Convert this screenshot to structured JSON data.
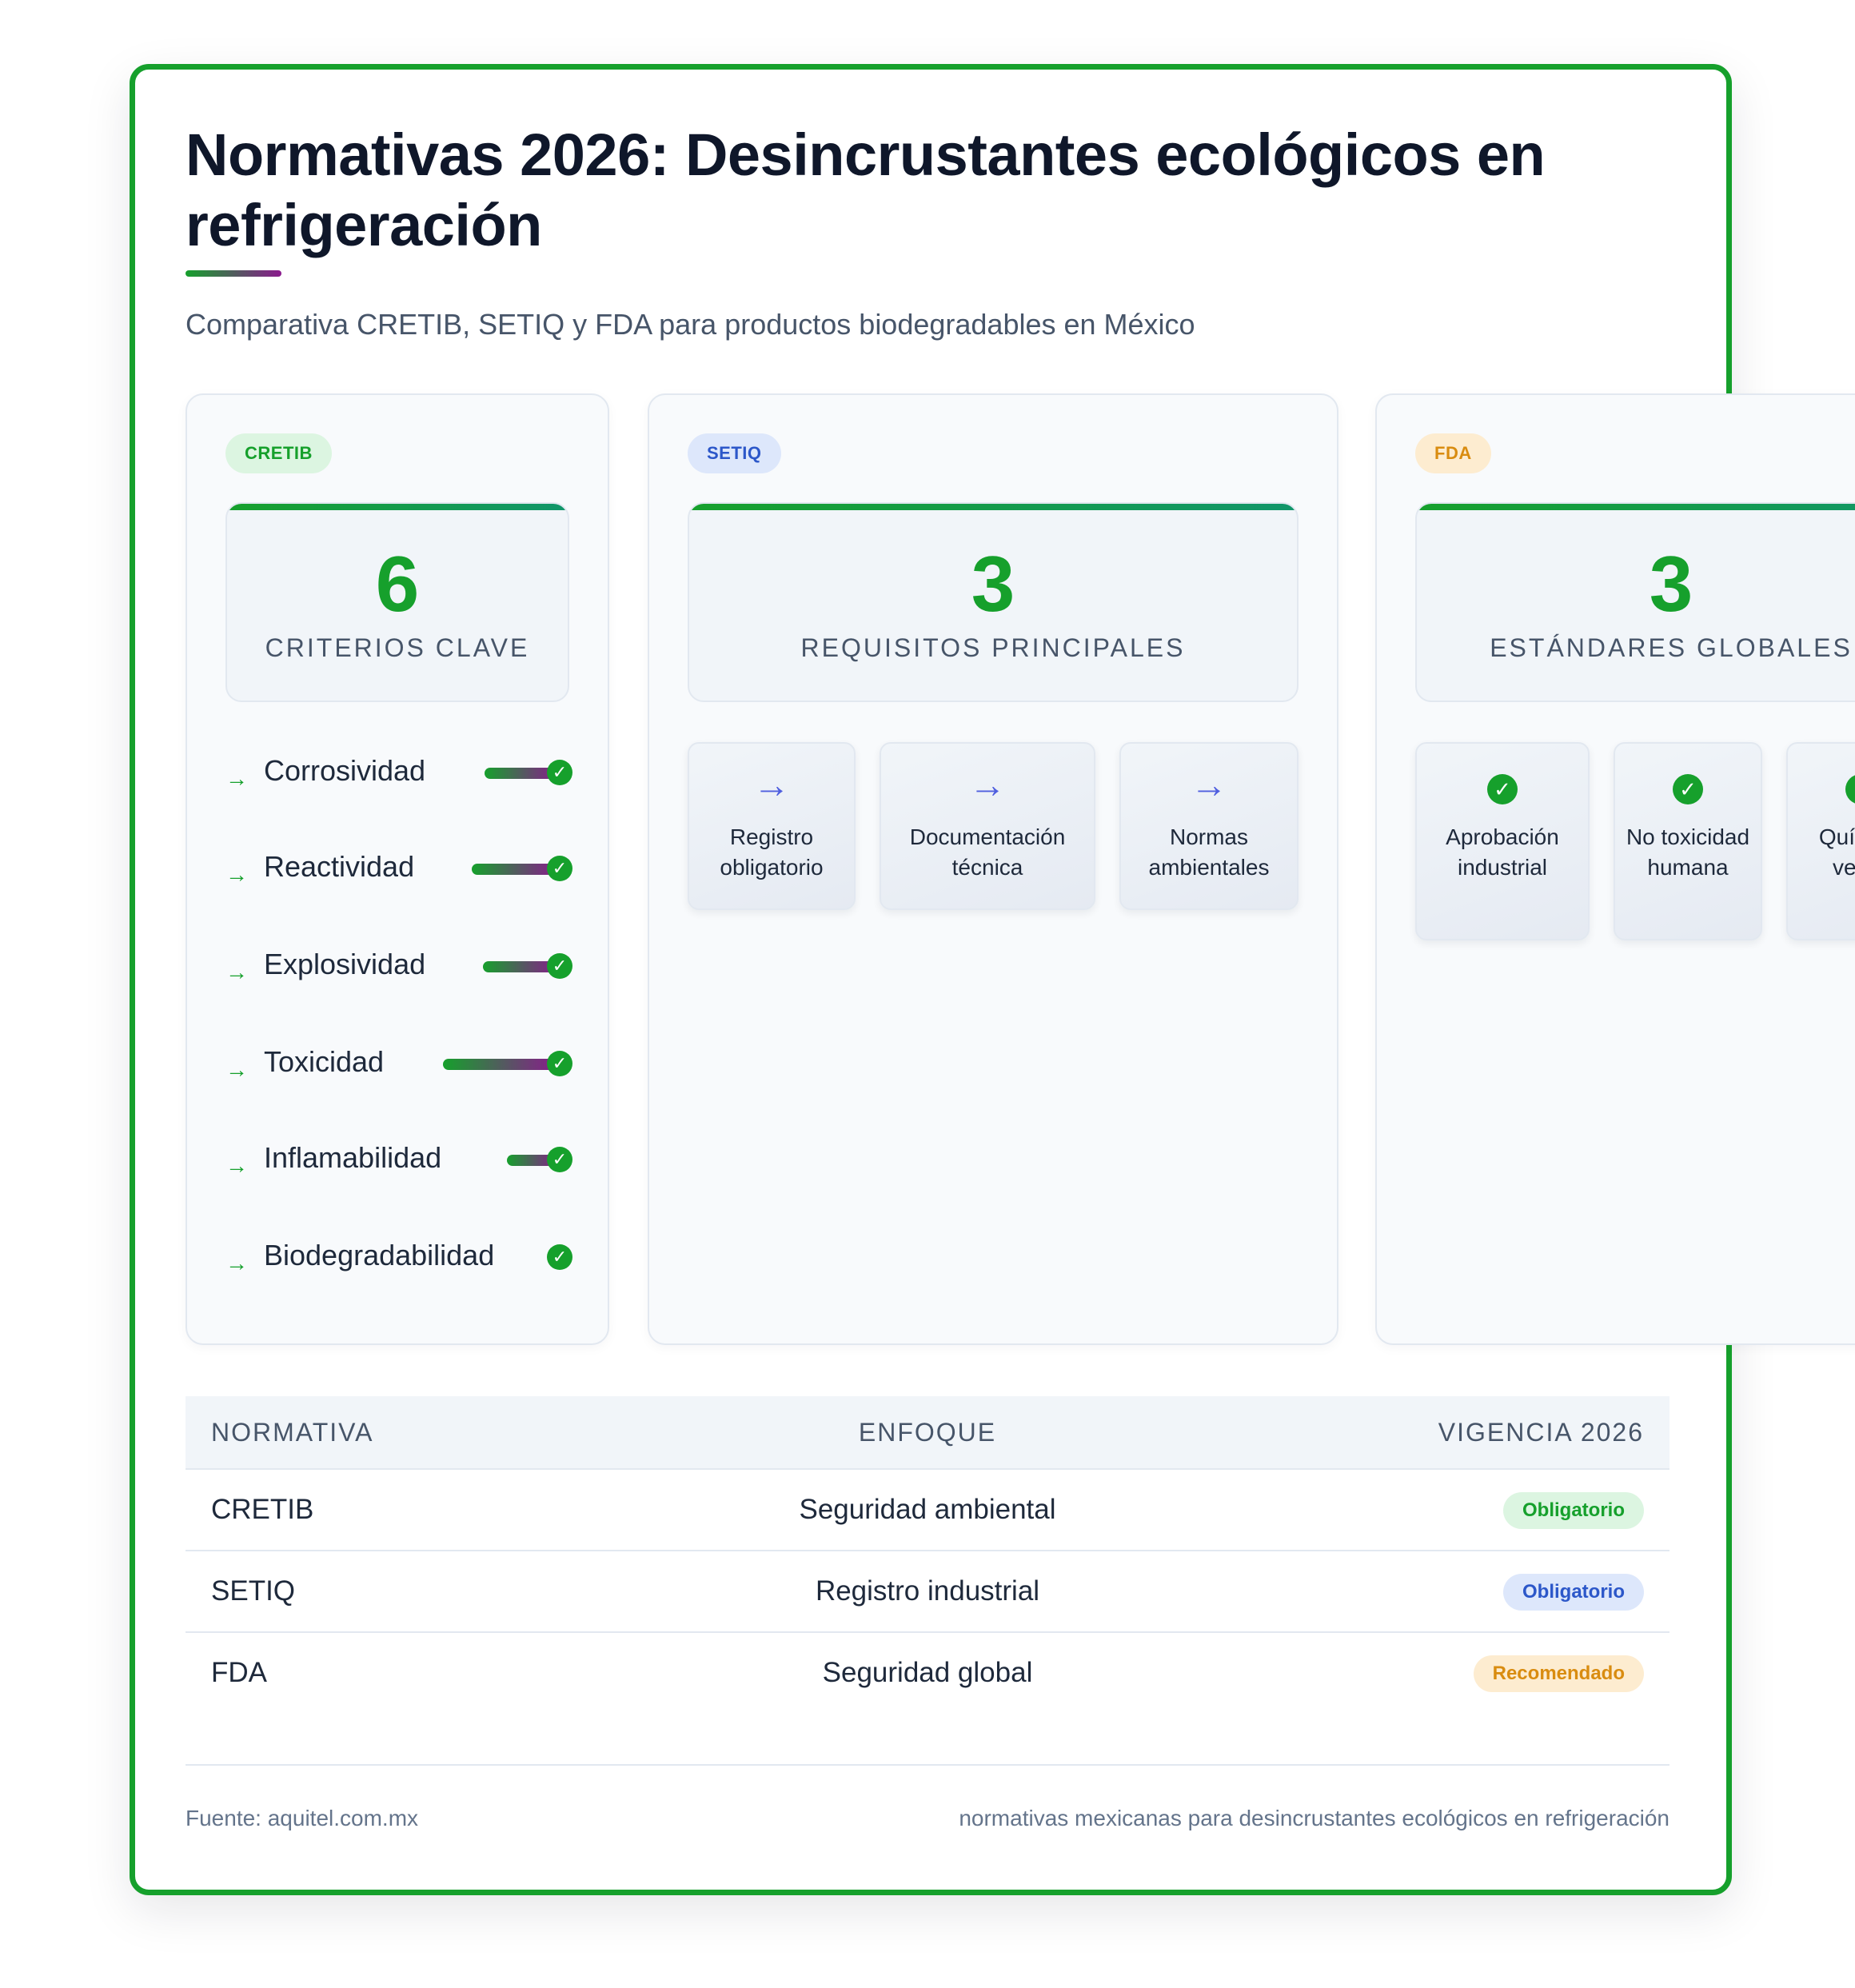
{
  "header": {
    "title": "Normativas 2026: Desincrustantes ecológicos en refrigeración",
    "subtitle": "Comparativa CRETIB, SETIQ y FDA para productos biodegradables en México"
  },
  "colors": {
    "brand_green": "#16a02c",
    "accent_purple": "#8b1a8e",
    "blue": "#2c57c9",
    "amber": "#d98c10"
  },
  "cretib": {
    "tag": "CRETIB",
    "stat_value": "6",
    "stat_label": "CRITERIOS CLAVE",
    "criteria": [
      {
        "arrow": "→",
        "name": "Corrosividad",
        "check": "✓"
      },
      {
        "arrow": "→",
        "name": "Reactividad",
        "check": "✓"
      },
      {
        "arrow": "→",
        "name": "Explosividad",
        "check": "✓"
      },
      {
        "arrow": "→",
        "name": "Toxicidad",
        "check": "✓"
      },
      {
        "arrow": "→",
        "name": "Inflamabilidad",
        "check": "✓"
      },
      {
        "arrow": "→",
        "name": "Biodegradabilidad",
        "check": "✓"
      }
    ]
  },
  "setiq": {
    "tag": "SETIQ",
    "stat_value": "3",
    "stat_label": "REQUISITOS PRINCIPALES",
    "requirements": [
      {
        "icon": "→",
        "label": "Registro obligatorio"
      },
      {
        "icon": "→",
        "label": "Documentación técnica"
      },
      {
        "icon": "→",
        "label": "Normas ambientales"
      }
    ]
  },
  "fda": {
    "tag": "FDA",
    "stat_value": "3",
    "stat_label": "ESTÁNDARES GLOBALES",
    "standards": [
      {
        "icon": "✓",
        "label": "Aprobación industrial"
      },
      {
        "icon": "✓",
        "label": "No toxicidad humana"
      },
      {
        "icon": "✓",
        "label": "Química verde"
      }
    ]
  },
  "table": {
    "headers": [
      "NORMATIVA",
      "ENFOQUE",
      "VIGENCIA 2026"
    ],
    "rows": [
      {
        "normativa": "CRETIB",
        "enfoque": "Seguridad ambiental",
        "vigencia": "Obligatorio"
      },
      {
        "normativa": "SETIQ",
        "enfoque": "Registro industrial",
        "vigencia": "Obligatorio"
      },
      {
        "normativa": "FDA",
        "enfoque": "Seguridad global",
        "vigencia": "Recomendado"
      }
    ]
  },
  "footer": {
    "source": "Fuente: aquitel.com.mx",
    "keywords": "normativas mexicanas para desincrustantes ecológicos en refrigeración"
  }
}
